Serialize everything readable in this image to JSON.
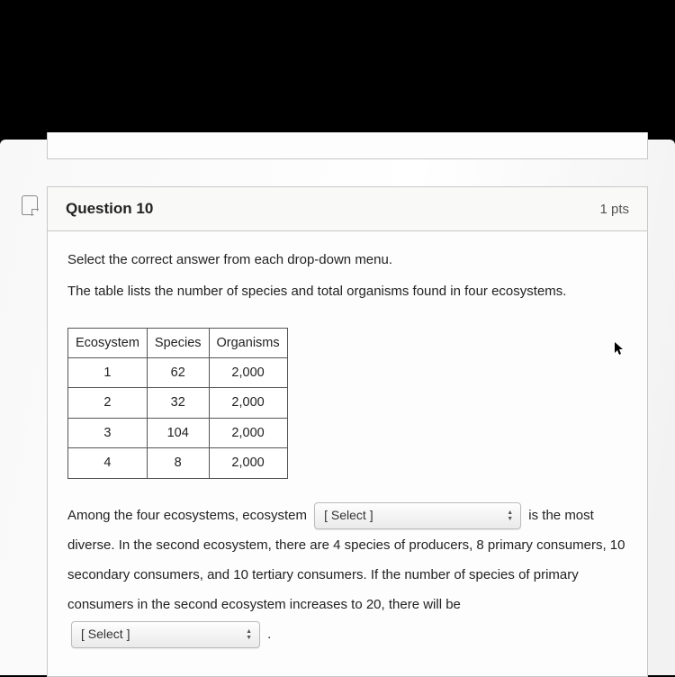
{
  "question": {
    "title": "Question 10",
    "points": "1 pts",
    "instruction": "Select the correct answer from each drop-down menu.",
    "subtitle": "The table lists the number of species and total organisms found in four ecosystems."
  },
  "table": {
    "headers": [
      "Ecosystem",
      "Species",
      "Organisms"
    ],
    "rows": [
      {
        "ecosystem": "1",
        "species": "62",
        "organisms": "2,000"
      },
      {
        "ecosystem": "2",
        "species": "32",
        "organisms": "2,000"
      },
      {
        "ecosystem": "3",
        "species": "104",
        "organisms": "2,000"
      },
      {
        "ecosystem": "4",
        "species": "8",
        "organisms": "2,000"
      }
    ]
  },
  "sentence": {
    "part1": "Among the four ecosystems, ecosystem",
    "select1": "[ Select ]",
    "part2": "is the most diverse. In the second ecosystem, there are 4 species of producers, 8 primary consumers, 10 secondary consumers, and 10 tertiary consumers. If the number of species of primary consumers in the second ecosystem increases to 20, there will be",
    "select2": "[ Select ]",
    "part3": "."
  }
}
